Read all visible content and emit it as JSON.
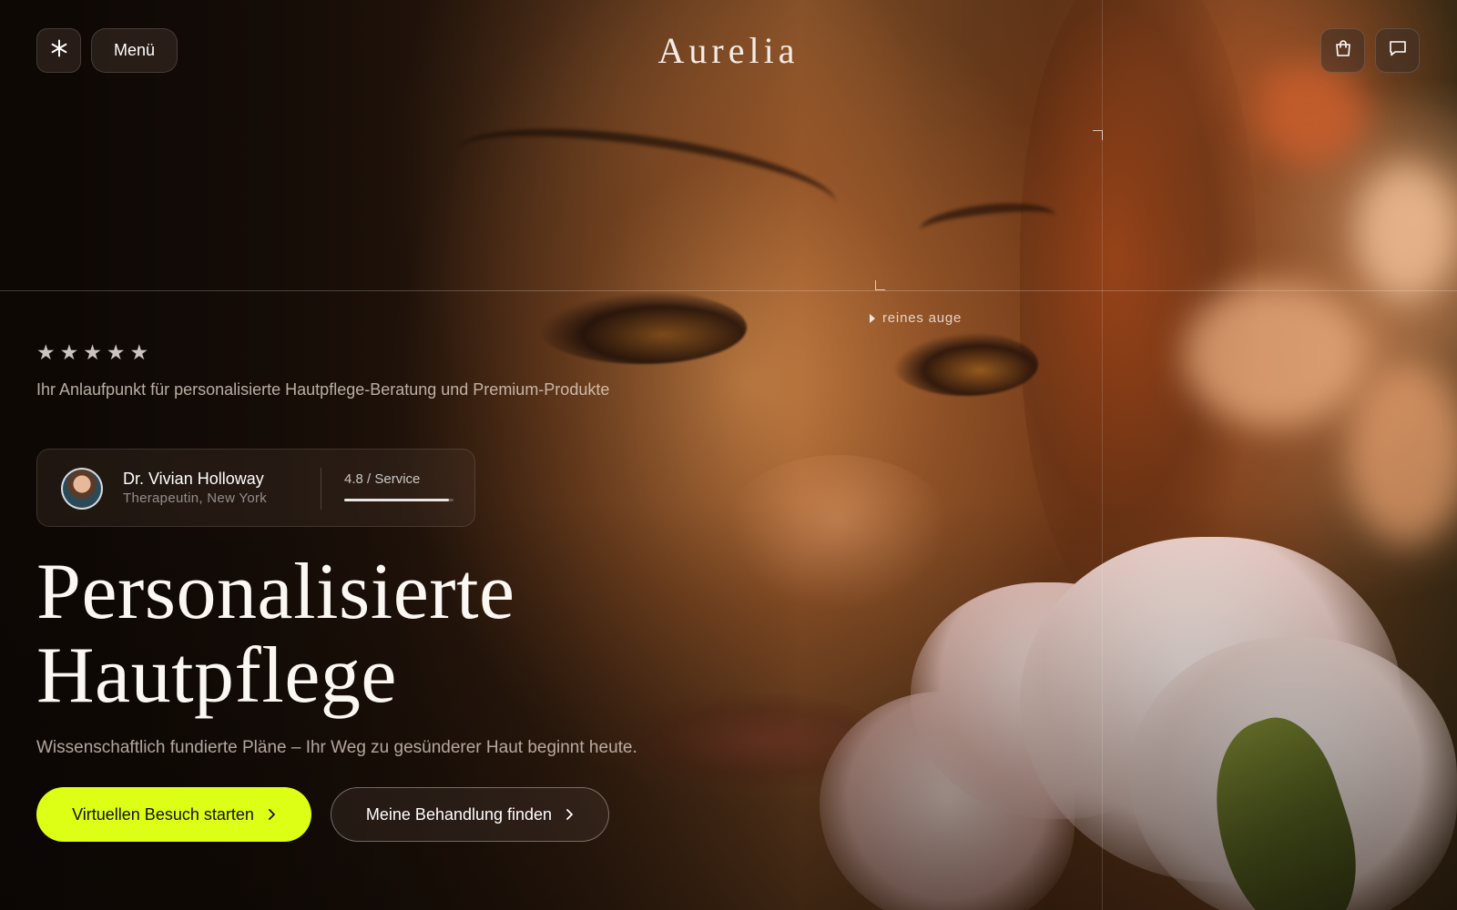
{
  "header": {
    "brand": "Aurelia",
    "menu_label": "Menü",
    "icons": [
      "asterisk-icon",
      "shopping-bag-icon",
      "chat-bubble-icon"
    ]
  },
  "annotation": {
    "label": "reines auge"
  },
  "hero": {
    "rating_stars": 5,
    "stars": [
      "★",
      "★",
      "★",
      "★",
      "★"
    ],
    "tagline": "Ihr Anlaufpunkt für personalisierte Hautpflege-Beratung und Premium-Produkte",
    "doctor": {
      "name": "Dr. Vivian Holloway",
      "role": "Therapeutin, New York",
      "rating_text": "4.8 / Service",
      "rating_value": 4.8,
      "rating_max": 5
    },
    "headline_line1": "Personalisierte",
    "headline_line2": "Hautpflege",
    "subline": "Wissenschaftlich fundierte Pläne – Ihr Weg zu gesünderer Haut beginnt heute.",
    "cta_primary": "Virtuellen Besuch starten",
    "cta_secondary": "Meine Behandlung finden"
  },
  "colors": {
    "accent": "#ddff16",
    "text": "#ffffff"
  }
}
